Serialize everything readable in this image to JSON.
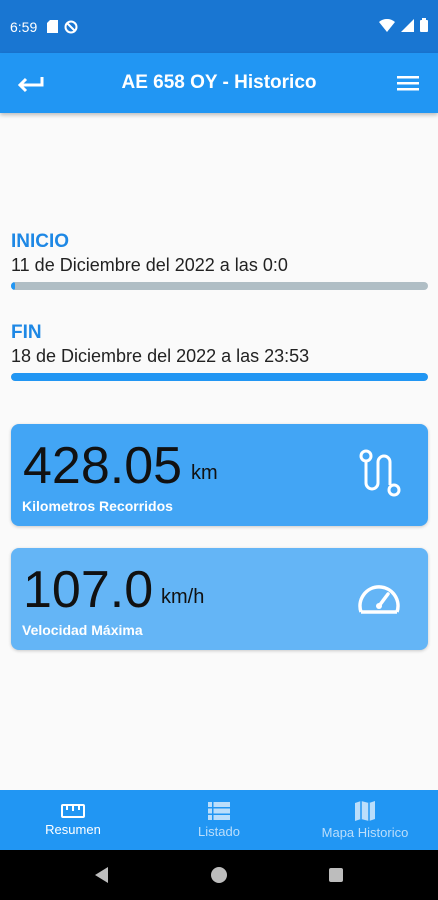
{
  "status_bar": {
    "time": "6:59",
    "left_icons": [
      "sd-card-icon",
      "no-signal-icon"
    ],
    "right_icons": [
      "wifi-icon",
      "cell-signal-icon",
      "battery-icon"
    ]
  },
  "app_bar": {
    "title": "AE 658 OY - Historico",
    "back_icon": "back-arrow-icon",
    "menu_icon": "hamburger-menu-icon"
  },
  "inicio": {
    "label": "INICIO",
    "date": "11 de Diciembre del 2022 a las 0:0",
    "progress": 0.01
  },
  "fin": {
    "label": "FIN",
    "date": "18 de Diciembre del 2022 a las 23:53",
    "progress": 1.0
  },
  "cards": [
    {
      "value": "428.05",
      "unit": "km",
      "caption": "Kilometros Recorridos",
      "icon": "route-icon",
      "color": "#42a5f5"
    },
    {
      "value": "107.0",
      "unit": "km/h",
      "caption": "Velocidad Máxima",
      "icon": "speedometer-icon",
      "color": "#64b5f6"
    }
  ],
  "bottom_nav": [
    {
      "label": "Resumen",
      "icon": "ruler-icon",
      "active": true
    },
    {
      "label": "Listado",
      "icon": "list-icon",
      "active": false
    },
    {
      "label": "Mapa Historico",
      "icon": "map-icon",
      "active": false
    }
  ],
  "colors": {
    "primary": "#2196f3",
    "primary_dark": "#1976d2",
    "accent_text": "#1e88e5",
    "progress_track": "#b0bec5",
    "nav_active": "#ffffff",
    "nav_inactive": "#bbdefb"
  },
  "system_nav": [
    "back-triangle-icon",
    "home-circle-icon",
    "recents-square-icon"
  ]
}
